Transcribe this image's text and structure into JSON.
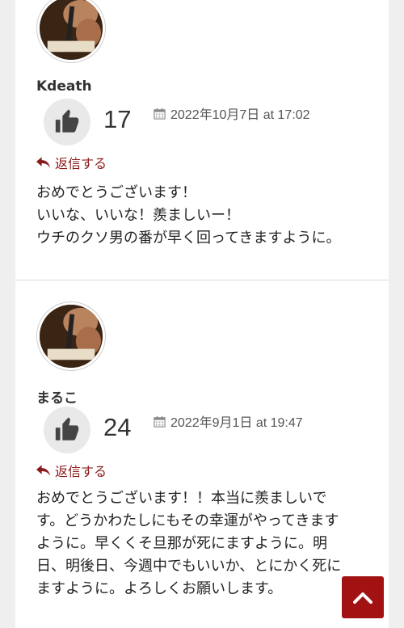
{
  "comments": [
    {
      "author": "Kdeath",
      "likes": "17",
      "date": "2022年10月7日 at 17:02",
      "reply_label": "返信する",
      "lines": [
        "おめでとうございます！",
        "いいな、いいな！羨ましいー！",
        "ウチのクソ男の番が早く回ってきますように。"
      ]
    },
    {
      "author": "まるこ",
      "likes": "24",
      "date": "2022年9月1日 at 19:47",
      "reply_label": "返信する",
      "lines": [
        "おめでとうございます！！本当に羨ましいで",
        "す。どうかわたしにもその幸運がやってきます",
        "ように。早くくそ旦那が死にますように。明",
        "日、明後日、今週中でもいいか、とにかく死に",
        "ますように。よろしくお願いします。"
      ]
    }
  ],
  "icons": {
    "like": "thumbs-up-icon",
    "calendar": "calendar-icon",
    "reply": "reply-icon",
    "scroll_top": "chevron-up-icon"
  },
  "colors": {
    "accent": "#a31212",
    "reply_text": "#8b1a1a"
  }
}
